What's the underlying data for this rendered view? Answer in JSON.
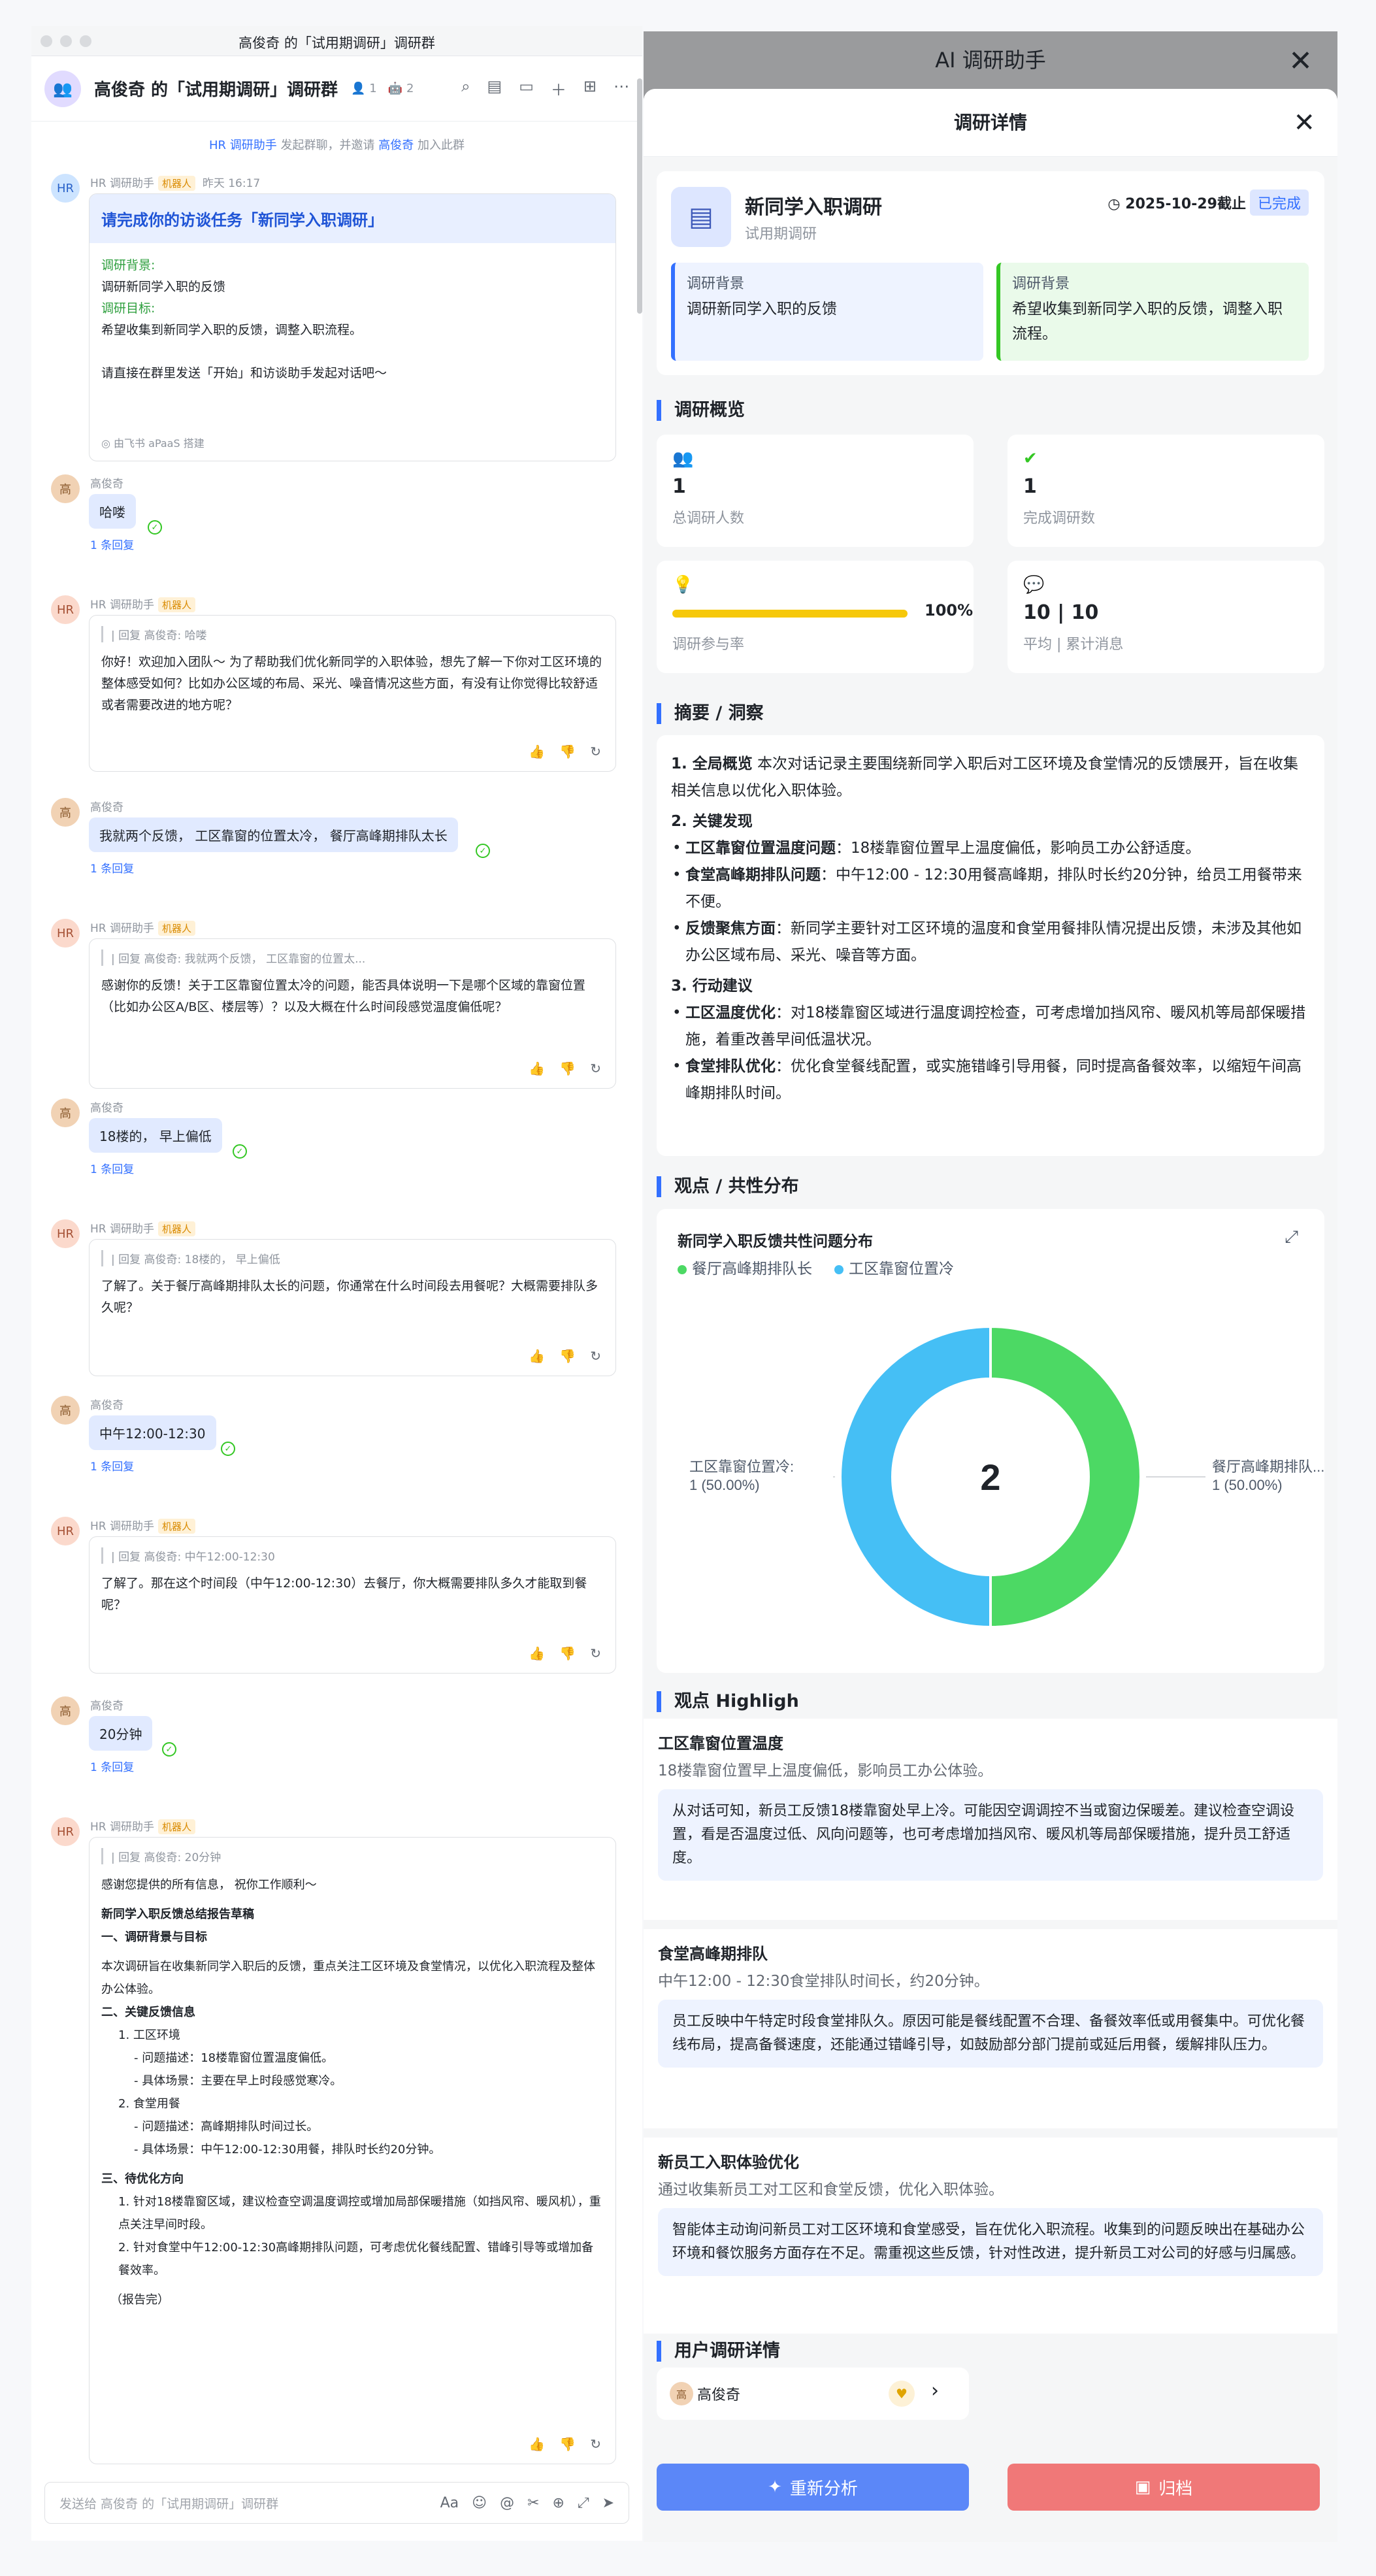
{
  "window": {
    "title": "高俊奇 的「试用期调研」调研群"
  },
  "chat": {
    "header": {
      "avatar_icon": "group-icon",
      "title": "高俊奇 的「试用期调研」调研群",
      "members": "1",
      "bots": "2"
    },
    "notice": {
      "pre": "HR 调研助手",
      "mid": " 发起群聊，并邀请 ",
      "link": "高俊奇",
      "post": " 加入此群"
    },
    "bot_name": "HR 调研助手",
    "bot_tag": "机器人",
    "user_name": "高俊奇",
    "reply_count": "1 条回复",
    "task": {
      "time": "昨天 16:17",
      "heading": "请完成你的访谈任务「新同学入职调研」",
      "bg_label": "调研背景:",
      "bg_text": "调研新同学入职的反馈",
      "goal_label": "调研目标:",
      "goal_text": "希望收集到新同学入职的反馈，调整入职流程。",
      "instruction": "请直接在群里发送「开始」和访谈助手发起对话吧～",
      "footer": "由飞书 aPaaS 搭建"
    },
    "user_msgs": [
      "哈喽",
      "我就两个反馈， 工区靠窗的位置太冷， 餐厅高峰期排队太长",
      "18楼的， 早上偏低",
      "中午12:00-12:30",
      "20分钟"
    ],
    "bot_msgs": [
      {
        "quote": "| 回复 高俊奇: 哈喽",
        "text": "你好！欢迎加入团队～ 为了帮助我们优化新同学的入职体验，想先了解一下你对工区环境的整体感受如何？比如办公区域的布局、采光、噪音情况这些方面，有没有让你觉得比较舒适或者需要改进的地方呢？"
      },
      {
        "quote": "| 回复 高俊奇: 我就两个反馈， 工区靠窗的位置太...",
        "text": "感谢你的反馈！关于工区靠窗位置太冷的问题，能否具体说明一下是哪个区域的靠窗位置（比如办公区A/B区、楼层等）？以及大概在什么时间段感觉温度偏低呢？"
      },
      {
        "quote": "| 回复 高俊奇: 18楼的， 早上偏低",
        "text": "了解了。关于餐厅高峰期排队太长的问题，你通常在什么时间段去用餐呢？大概需要排队多久呢？"
      },
      {
        "quote": "| 回复 高俊奇: 中午12:00-12:30",
        "text": "了解了。那在这个时间段（中午12:00-12:30）去餐厅，你大概需要排队多久才能取到餐呢？"
      }
    ],
    "report": {
      "quote": "| 回复 高俊奇: 20分钟",
      "lines": [
        "感谢您提供的所有信息， 祝你工作顺利～",
        "新同学入职反馈总结报告草稿",
        "一、调研背景与目标",
        "本次调研旨在收集新同学入职后的反馈，重点关注工区环境及食堂情况，以优化入职流程及整体办公体验。",
        "二、关键反馈信息",
        "1. 工区环境",
        "- 问题描述：18楼靠窗位置温度偏低。",
        "- 具体场景：主要在早上时段感觉寒冷。",
        "2. 食堂用餐",
        "- 问题描述：高峰期排队时间过长。",
        "- 具体场景：中午12:00-12:30用餐，排队时长约20分钟。",
        "三、待优化方向",
        "1. 针对18楼靠窗区域，建议检查空调温度调控或增加局部保暖措施（如挡风帘、暖风机），重点关注早间时段。",
        "2. 针对食堂中午12:00-12:30高峰期排队问题，可考虑优化餐线配置、错峰引导等或增加备餐效率。",
        "（报告完）"
      ]
    },
    "input_placeholder": "发送给 高俊奇 的「试用期调研」调研群"
  },
  "overlay": {
    "title": "AI 调研助手",
    "panel_title": "调研详情",
    "survey": {
      "name": "新同学入职调研",
      "type": "试用期调研",
      "deadline": "2025-10-29截止",
      "status": "已完成"
    },
    "background": {
      "label": "调研背景",
      "text": "调研新同学入职的反馈"
    },
    "goal": {
      "label": "调研背景",
      "text": "希望收集到新同学入职的反馈，调整入职流程。"
    },
    "overview": {
      "title": "调研概览",
      "total_value": "1",
      "total_label": "总调研人数",
      "done_value": "1",
      "done_label": "完成调研数",
      "rate_value": "100%",
      "rate_fraction": 1.0,
      "rate_label": "调研参与率",
      "avg_value": "10",
      "sum_value": "10",
      "msg_label": "平均 | 累计消息"
    },
    "summary": {
      "title": "摘要 / 洞察",
      "p1_lead": "1. 全局概览",
      "p1_text": " 本次对话记录主要围绕新同学入职后对工区环境及食堂情况的反馈展开，旨在收集相关信息以优化入职体验。",
      "h2": "2. 关键发现",
      "f1_lead": "工区靠窗位置温度问题",
      "f1_text": "：18楼靠窗位置早上温度偏低，影响员工办公舒适度。",
      "f2_lead": "食堂高峰期排队问题",
      "f2_text": "：中午12:00 - 12:30用餐高峰期，排队时长约20分钟，给员工用餐带来不便。",
      "f3_lead": "反馈聚焦方面",
      "f3_text": "：新同学主要针对工区环境的温度和食堂用餐排队情况提出反馈，未涉及其他如办公区域布局、采光、噪音等方面。",
      "h3": "3. 行动建议",
      "a1_lead": "工区温度优化",
      "a1_text": "：对18楼靠窗区域进行温度调控检查，可考虑增加挡风帘、暖风机等局部保暖措施，着重改善早间低温状况。",
      "a2_lead": "食堂排队优化",
      "a2_text": "：优化食堂餐线配置，或实施错峰引导用餐，同时提高备餐效率，以缩短午间高峰期排队时间。"
    },
    "distribution": {
      "title": "观点 / 共性分布"
    },
    "highlights": {
      "title": "观点 Highligh",
      "items": [
        {
          "title": "工区靠窗位置温度",
          "sub": "18楼靠窗位置早上温度偏低，影响员工办公体验。",
          "detail": "从对话可知，新员工反馈18楼靠窗处早上冷。可能因空调调控不当或窗边保暖差。建议检查空调设置，看是否温度过低、风向问题等，也可考虑增加挡风帘、暖风机等局部保暖措施，提升员工舒适度。"
        },
        {
          "title": "食堂高峰期排队",
          "sub": "中午12:00 - 12:30食堂排队时间长，约20分钟。",
          "detail": "员工反映中午特定时段食堂排队久。原因可能是餐线配置不合理、备餐效率低或用餐集中。可优化餐线布局，提高备餐速度，还能通过错峰引导，如鼓励部分部门提前或延后用餐，缓解排队压力。"
        },
        {
          "title": "新员工入职体验优化",
          "sub": "通过收集新员工对工区和食堂反馈，优化入职体验。",
          "detail": "智能体主动询问新员工对工区环境和食堂感受，旨在优化入职流程。收集到的问题反映出在基础办公环境和餐饮服务方面存在不足。需重视这些反馈，针对性改进，提升新员工对公司的好感与归属感。"
        }
      ]
    },
    "users": {
      "title": "用户调研详情",
      "name": "高俊奇"
    },
    "buttons": {
      "reanalyze": "重新分析",
      "archive": "归档"
    }
  },
  "chart_data": {
    "type": "pie",
    "title": "新同学入职反馈共性问题分布",
    "center_label": "2",
    "categories": [
      "餐厅高峰期排队长",
      "工区靠窗位置冷"
    ],
    "values": [
      1,
      1
    ],
    "percent_labels": [
      "1 (50.00%)",
      "1 (50.00%)"
    ],
    "slice_labels": [
      "餐厅高峰期排队...",
      "工区靠窗位置冷:"
    ],
    "colors": [
      "#4cd964",
      "#45bff5"
    ],
    "legend_position": "top-left"
  }
}
